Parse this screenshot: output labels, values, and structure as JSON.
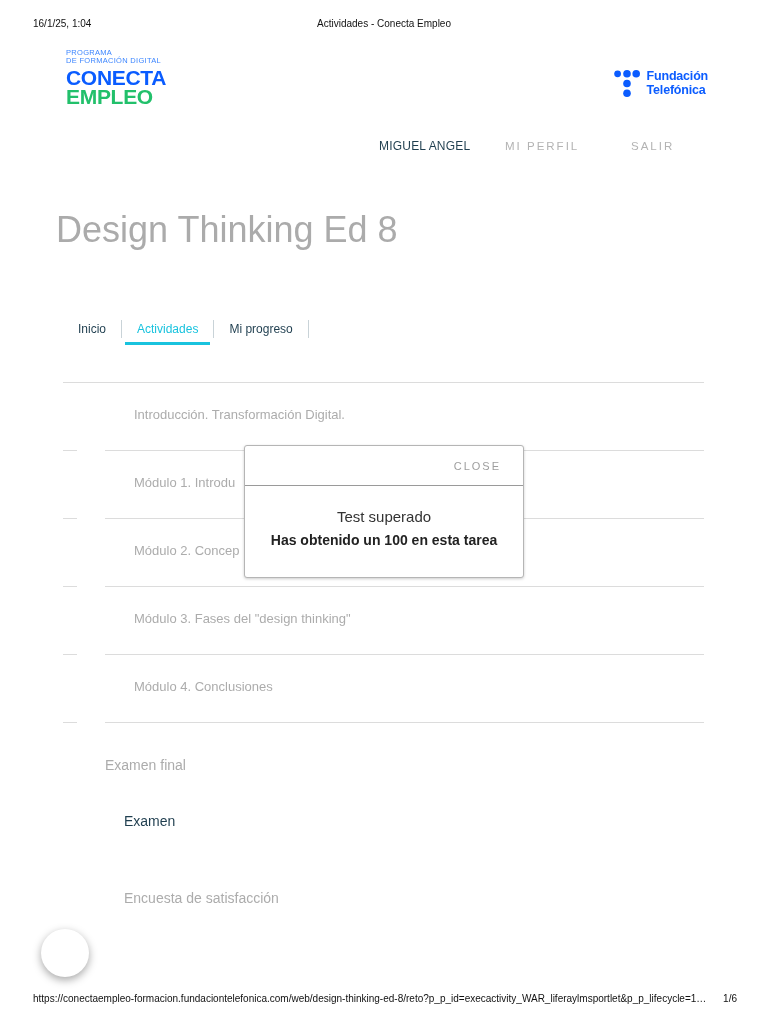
{
  "print_header": {
    "date": "16/1/25, 1:04",
    "title": "Actividades - Conecta Empleo"
  },
  "logo": {
    "tagline": [
      "PROGRAMA",
      "DE FORMACIÓN DIGITAL"
    ],
    "wordmark": [
      "CONECTA",
      "EMPLEO"
    ]
  },
  "partner_logo": {
    "lines": [
      "Fundación",
      "Telefónica"
    ]
  },
  "nav": [
    {
      "label": "MIGUEL ANGEL",
      "kind": "user"
    },
    {
      "label": "MI PERFIL",
      "kind": "link"
    },
    {
      "label": "SALIR",
      "kind": "link"
    }
  ],
  "course_title": "Design Thinking Ed 8",
  "tabs": [
    {
      "label": "Inicio",
      "selected": false
    },
    {
      "label": "Actividades",
      "selected": true
    },
    {
      "label": "Mi progreso",
      "selected": false
    }
  ],
  "modules": [
    {
      "title": "Introducción. Transformación Digital.",
      "disabled": true
    },
    {
      "title": "Módulo 1. Introdu",
      "disabled": true
    },
    {
      "title": "Módulo 2. Concep",
      "disabled": true
    },
    {
      "title": "Módulo 3. Fases del \"design thinking\"",
      "disabled": true
    },
    {
      "title": "Módulo 4. Conclusiones",
      "disabled": true
    }
  ],
  "final_section": {
    "title": "Examen final",
    "items": [
      {
        "label": "Examen",
        "disabled": false
      },
      {
        "label": "Encuesta de satisfacción",
        "disabled": true
      }
    ]
  },
  "dialog": {
    "close_label": "CLOSE",
    "title": "Test superado",
    "message": "Has obtenido un 100 en esta tarea"
  },
  "print_footer": {
    "url": "https://conectaempleo-formacion.fundaciontelefonica.com/web/design-thinking-ed-8/reto?p_p_id=execactivity_WAR_liferaylmsportlet&p_p_lifecycle=1…",
    "page": "1/6"
  }
}
